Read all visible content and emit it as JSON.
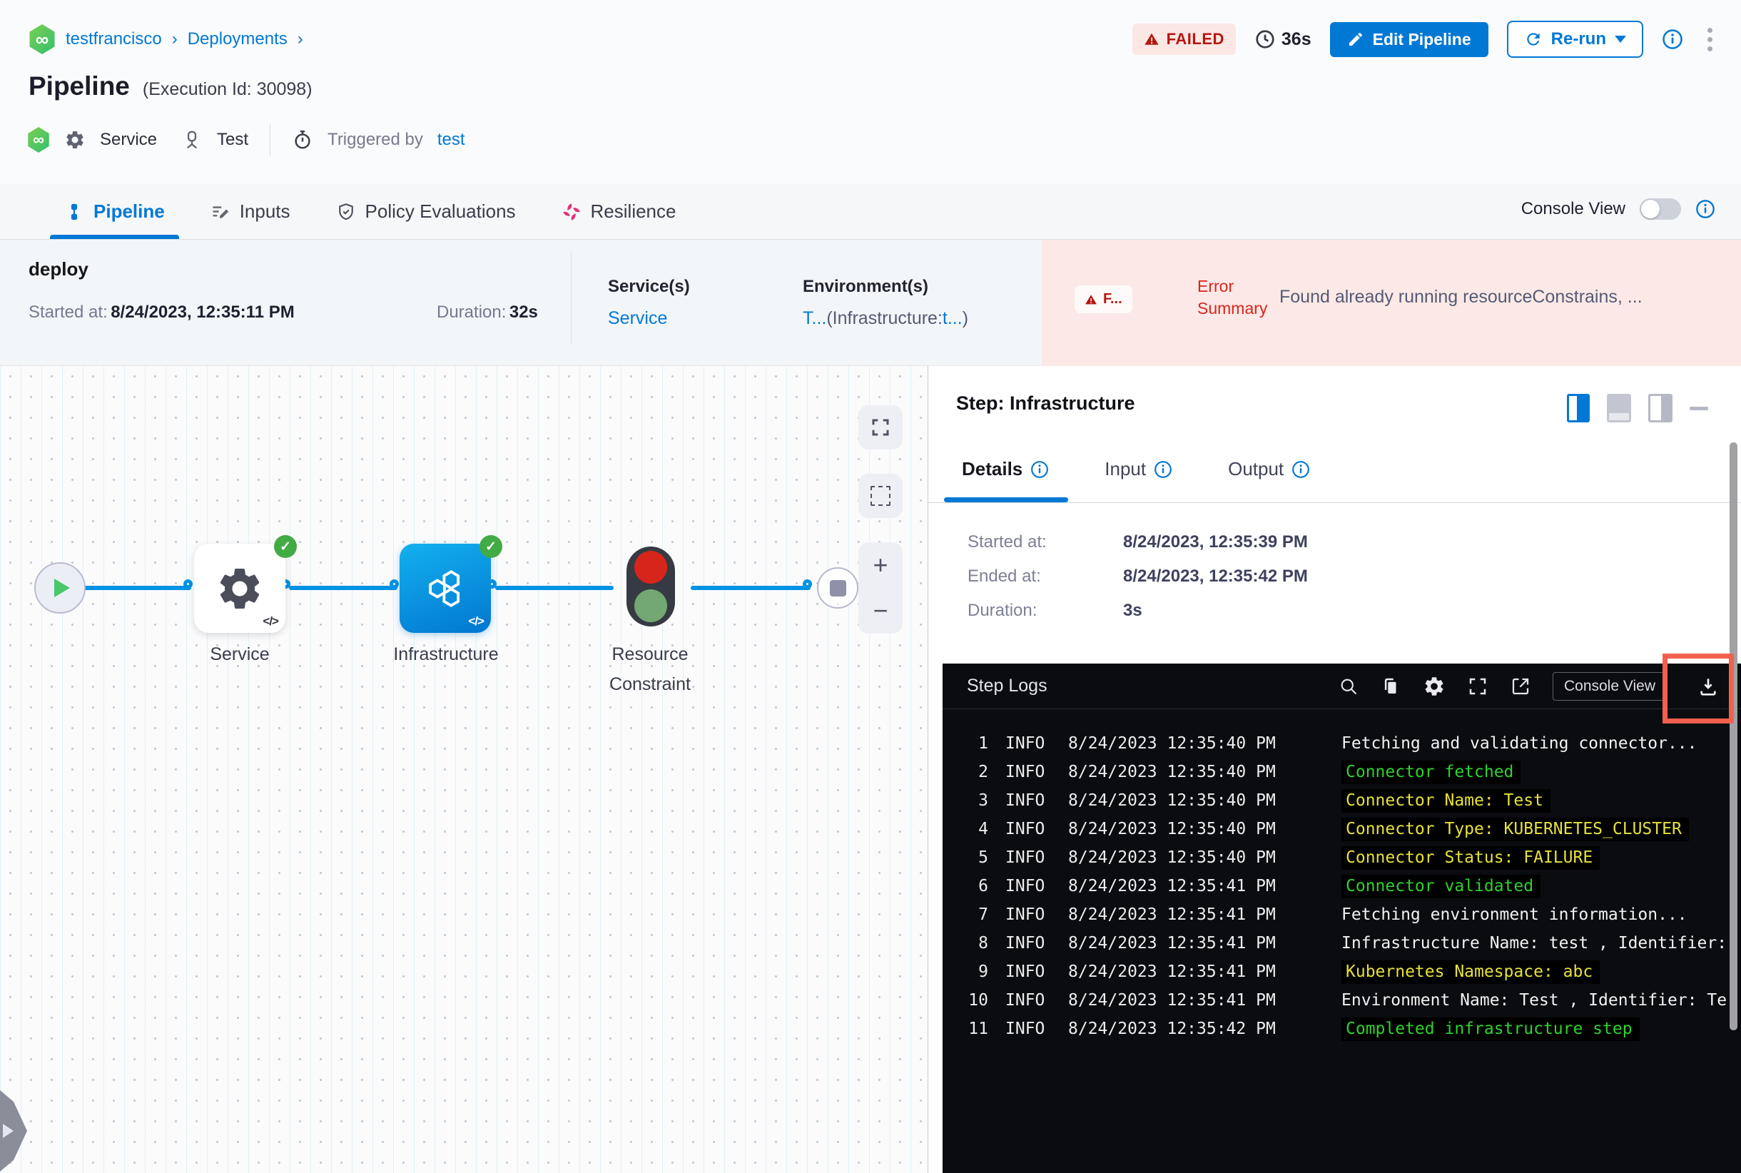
{
  "app": {
    "accent": "#0278d5",
    "failed_red": "#b41710",
    "error_bg": "#fce9e7",
    "success_green": "#42ab45",
    "node_blue": "#0092e4",
    "log_green": "#2fd12f",
    "log_yellow": "#e6e13c",
    "annotation_red": "#f2604e"
  },
  "breadcrumb": {
    "project": "testfrancisco",
    "section": "Deployments",
    "separator": "›"
  },
  "header": {
    "title": "Pipeline",
    "execution_id": "(Execution Id: 30098)",
    "status_badge": "FAILED",
    "elapsed": "36s",
    "edit_button": "Edit Pipeline",
    "rerun_button": "Re-run",
    "meta_service": "Service",
    "meta_test": "Test",
    "triggered_by_label": "Triggered by",
    "triggered_by_value": "test"
  },
  "tab_bar": {
    "tabs": [
      {
        "label": "Pipeline"
      },
      {
        "label": "Inputs"
      },
      {
        "label": "Policy Evaluations"
      },
      {
        "label": "Resilience"
      }
    ],
    "console_view_label": "Console View"
  },
  "summary": {
    "stage_name": "deploy",
    "started_label": "Started at:",
    "started_value": "8/24/2023, 12:35:11 PM",
    "duration_label": "Duration:",
    "duration_value": "32s",
    "services_label": "Service(s)",
    "services_value": "Service",
    "environments_label": "Environment(s)",
    "env_part1": "T...",
    "env_part2": "(Infrastructure:",
    "env_part3": "t...",
    "env_part4": ")",
    "error_badge": "F...",
    "error_label_line1": "Error",
    "error_label_line2": "Summary",
    "error_message": "Found already running resourceConstrains, ..."
  },
  "graph": {
    "node1_label": "Service",
    "node2_label": "Infrastructure",
    "node3_label_line1": "Resource",
    "node3_label_line2": "Constraint",
    "code_glyph": "</>",
    "check_glyph": "✓",
    "zoom_in": "+",
    "zoom_out": "−"
  },
  "step_panel": {
    "title": "Step: Infrastructure",
    "tabs": [
      {
        "label": "Details"
      },
      {
        "label": "Input"
      },
      {
        "label": "Output"
      }
    ],
    "details": [
      {
        "label": "Started at:",
        "value": "8/24/2023, 12:35:39 PM"
      },
      {
        "label": "Ended at:",
        "value": "8/24/2023, 12:35:42 PM"
      },
      {
        "label": "Duration:",
        "value": "3s"
      }
    ]
  },
  "logs": {
    "title": "Step Logs",
    "console_view_button": "Console View",
    "lines": [
      {
        "n": "1",
        "level": "INFO",
        "time": "8/24/2023 12:35:40 PM",
        "msg": "Fetching and validating connector...",
        "color": "white",
        "hl": false
      },
      {
        "n": "2",
        "level": "INFO",
        "time": "8/24/2023 12:35:40 PM",
        "msg": "Connector fetched",
        "color": "green",
        "hl": true
      },
      {
        "n": "3",
        "level": "INFO",
        "time": "8/24/2023 12:35:40 PM",
        "msg": "Connector Name: Test",
        "color": "yellow",
        "hl": true
      },
      {
        "n": "4",
        "level": "INFO",
        "time": "8/24/2023 12:35:40 PM",
        "msg": "Connector Type: KUBERNETES_CLUSTER",
        "color": "yellow",
        "hl": true
      },
      {
        "n": "5",
        "level": "INFO",
        "time": "8/24/2023 12:35:40 PM",
        "msg": "Connector Status: FAILURE",
        "color": "yellow",
        "hl": true
      },
      {
        "n": "6",
        "level": "INFO",
        "time": "8/24/2023 12:35:41 PM",
        "msg": "Connector validated",
        "color": "green",
        "hl": true
      },
      {
        "n": "7",
        "level": "INFO",
        "time": "8/24/2023 12:35:41 PM",
        "msg": "Fetching environment information...",
        "color": "white",
        "hl": false
      },
      {
        "n": "8",
        "level": "INFO",
        "time": "8/24/2023 12:35:41 PM",
        "msg": "Infrastructure Name: test , Identifier:",
        "color": "white",
        "hl": false
      },
      {
        "n": "9",
        "level": "INFO",
        "time": "8/24/2023 12:35:41 PM",
        "msg": "Kubernetes Namespace: abc",
        "color": "yellow",
        "hl": true
      },
      {
        "n": "10",
        "level": "INFO",
        "time": "8/24/2023 12:35:41 PM",
        "msg": "Environment Name: Test , Identifier: Te",
        "color": "white",
        "hl": false
      },
      {
        "n": "11",
        "level": "INFO",
        "time": "8/24/2023 12:35:42 PM",
        "msg": "Completed infrastructure step",
        "color": "green",
        "hl": true
      }
    ]
  }
}
